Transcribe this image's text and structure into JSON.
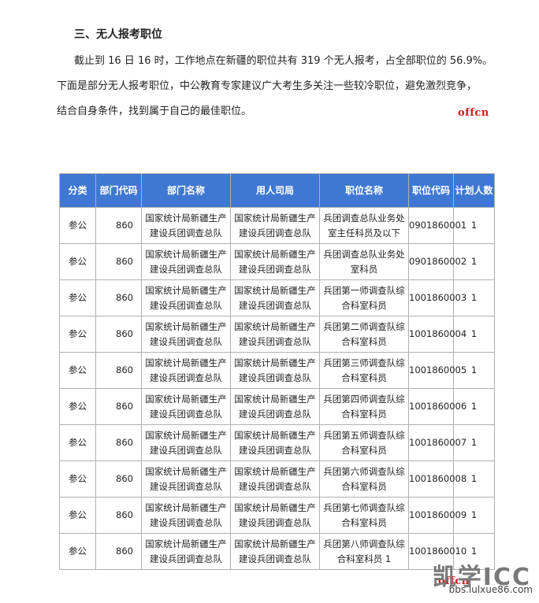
{
  "section_title": "三、无人报考职位",
  "intro": {
    "line1": "截止到 16 日 16 时，工作地点在新疆的职位共有 319 个无人报考，占全部职位的 56.9%。",
    "line2": "下面是部分无人报考职位，中公教育专家建议广大考生多关注一些较冷职位，避免激烈竞争，",
    "line3": "结合自身条件，找到属于自己的最佳职位。"
  },
  "logo_text": "offcn",
  "table": {
    "headers": [
      "分类",
      "部门代码",
      "部门名称",
      "用人司局",
      "职位名称",
      "职位代码",
      "计划人数"
    ],
    "rows": [
      {
        "cat": "参公",
        "dept_code": "860",
        "dept_name": "国家统计局新疆生产建设兵团调查总队",
        "bureau": "国家统计局新疆生产建设兵团调查总队",
        "position": "兵团调查总队业务处室主任科员及以下",
        "pos_code": "0901860001",
        "quota": "1"
      },
      {
        "cat": "参公",
        "dept_code": "860",
        "dept_name": "国家统计局新疆生产建设兵团调查总队",
        "bureau": "国家统计局新疆生产建设兵团调查总队",
        "position": "兵团调查总队业务处室科员",
        "pos_code": "0901860002",
        "quota": "1"
      },
      {
        "cat": "参公",
        "dept_code": "860",
        "dept_name": "国家统计局新疆生产建设兵团调查总队",
        "bureau": "国家统计局新疆生产建设兵团调查总队",
        "position": "兵团第一师调查队综合科室科员",
        "pos_code": "1001860003",
        "quota": "1"
      },
      {
        "cat": "参公",
        "dept_code": "860",
        "dept_name": "国家统计局新疆生产建设兵团调查总队",
        "bureau": "国家统计局新疆生产建设兵团调查总队",
        "position": "兵团第二师调查队综合科室科员",
        "pos_code": "1001860004",
        "quota": "1"
      },
      {
        "cat": "参公",
        "dept_code": "860",
        "dept_name": "国家统计局新疆生产建设兵团调查总队",
        "bureau": "国家统计局新疆生产建设兵团调查总队",
        "position": "兵团第三师调查队综合科室科员",
        "pos_code": "1001860005",
        "quota": "1"
      },
      {
        "cat": "参公",
        "dept_code": "860",
        "dept_name": "国家统计局新疆生产建设兵团调查总队",
        "bureau": "国家统计局新疆生产建设兵团调查总队",
        "position": "兵团第四师调查队综合科室科员",
        "pos_code": "1001860006",
        "quota": "1"
      },
      {
        "cat": "参公",
        "dept_code": "860",
        "dept_name": "国家统计局新疆生产建设兵团调查总队",
        "bureau": "国家统计局新疆生产建设兵团调查总队",
        "position": "兵团第五师调查队综合科室科员",
        "pos_code": "1001860007",
        "quota": "1"
      },
      {
        "cat": "参公",
        "dept_code": "860",
        "dept_name": "国家统计局新疆生产建设兵团调查总队",
        "bureau": "国家统计局新疆生产建设兵团调查总队",
        "position": "兵团第六师调查队综合科室科员",
        "pos_code": "1001860008",
        "quota": "1"
      },
      {
        "cat": "参公",
        "dept_code": "860",
        "dept_name": "国家统计局新疆生产建设兵团调查总队",
        "bureau": "国家统计局新疆生产建设兵团调查总队",
        "position": "兵团第七师调查队综合科室科员",
        "pos_code": "1001860009",
        "quota": "1"
      },
      {
        "cat": "参公",
        "dept_code": "860",
        "dept_name": "国家统计局新疆生产建设兵团调查总队",
        "bureau": "国家统计局新疆生产建设兵团调查总队",
        "position": "兵团第八师调查队综合科室科员 1",
        "pos_code": "1001860010",
        "quota": "1"
      }
    ]
  },
  "footer_badge": {
    "big": "凯学ICC",
    "url": "bbs.lulxue86.com"
  }
}
